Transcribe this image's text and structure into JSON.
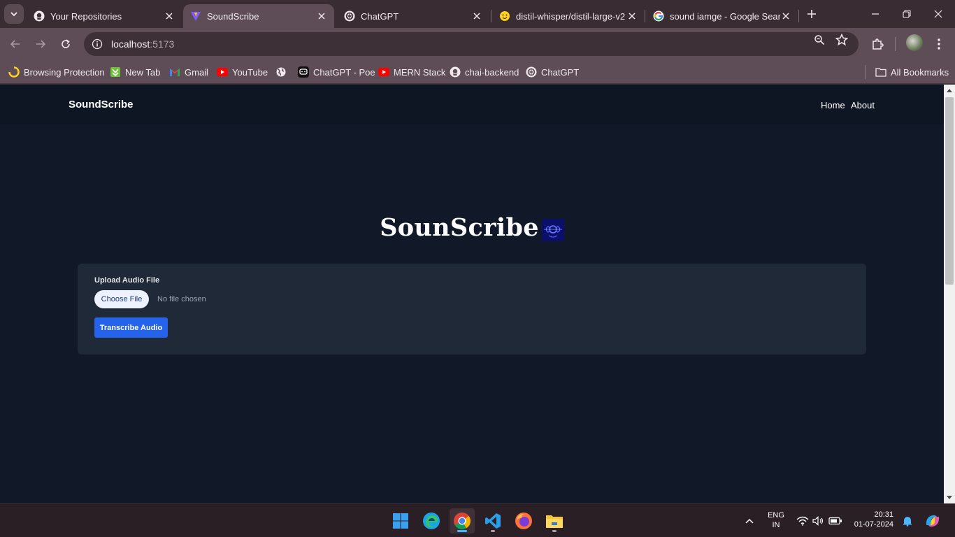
{
  "browser": {
    "tabs": [
      {
        "title": "Your Repositories",
        "icon": "github-icon"
      },
      {
        "title": "SoundScribe",
        "icon": "vite-icon",
        "active": true
      },
      {
        "title": "ChatGPT",
        "icon": "openai-icon"
      },
      {
        "title": "distil-whisper/distil-large-v2",
        "icon": "huggingface-icon"
      },
      {
        "title": "sound iamge - Google Searc",
        "icon": "google-icon"
      }
    ],
    "url_host": "localhost",
    "url_port": ":5173",
    "bookmarks": [
      {
        "label": "Browsing Protection",
        "icon": "shield-icon"
      },
      {
        "label": "New Tab",
        "icon": "new-tab-icon"
      },
      {
        "label": "Gmail",
        "icon": "gmail-icon"
      },
      {
        "label": "YouTube",
        "icon": "youtube-icon"
      },
      {
        "label": "",
        "icon": "globe-icon"
      },
      {
        "label": "ChatGPT - Poe",
        "icon": "poe-icon"
      },
      {
        "label": "MERN Stack",
        "icon": "youtube-icon"
      },
      {
        "label": "chai-backend",
        "icon": "github-icon"
      },
      {
        "label": "ChatGPT",
        "icon": "openai-icon"
      }
    ],
    "all_bookmarks": "All Bookmarks"
  },
  "app": {
    "brand": "SoundScribe",
    "nav": {
      "home": "Home",
      "about": "About"
    },
    "hero_title": "SounScribe",
    "upload_label": "Upload Audio File",
    "choose_file": "Choose File",
    "no_file": "No file chosen",
    "transcribe": "Transcribe Audio"
  },
  "taskbar": {
    "lang_line1": "ENG",
    "lang_line2": "IN",
    "time": "20:31",
    "date": "01-07-2024"
  },
  "colors": {
    "page_bg": "#111827",
    "card_bg": "#1f2937",
    "primary": "#2563eb"
  }
}
